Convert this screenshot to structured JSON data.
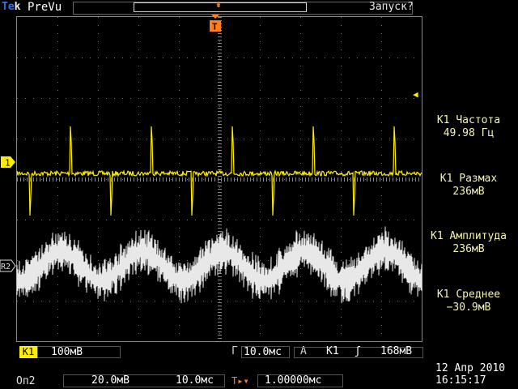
{
  "header": {
    "brand_t": "Te",
    "brand_k": "k",
    "mode": "PreVu",
    "status": "Запуск?"
  },
  "markers": {
    "ch1": "1",
    "ref2": "R2",
    "trigger": "T"
  },
  "measurements": [
    {
      "label": "К1 Частота",
      "value": "49.98 Гц"
    },
    {
      "label": "К1 Размах",
      "value": "236мВ"
    },
    {
      "label": "К1 Амплитуда",
      "value": "236мВ"
    },
    {
      "label": "К1 Среднее",
      "value": "−30.9мВ"
    }
  ],
  "channel1": {
    "tag": "К1",
    "scale": "100мВ"
  },
  "timebase": {
    "label": "Г",
    "value": "10.0мс"
  },
  "trigger": {
    "label": "А",
    "source": "К1",
    "edge_icon": "rising-edge-icon",
    "edge_glyph": "ʃ",
    "level": "168мВ",
    "position_glyph": "T▸▾",
    "position": "1.00000мс"
  },
  "reference": {
    "label": "Оп2",
    "volts": "20.0мВ",
    "time": "10.0мс"
  },
  "datetime": {
    "date": "12 Апр 2010",
    "time": "16:15:17"
  },
  "colors": {
    "ch1": "#ffee00",
    "ref": "#e0e0e0",
    "trigger": "#ff7f1a",
    "brand": "#3a6ee6"
  }
}
